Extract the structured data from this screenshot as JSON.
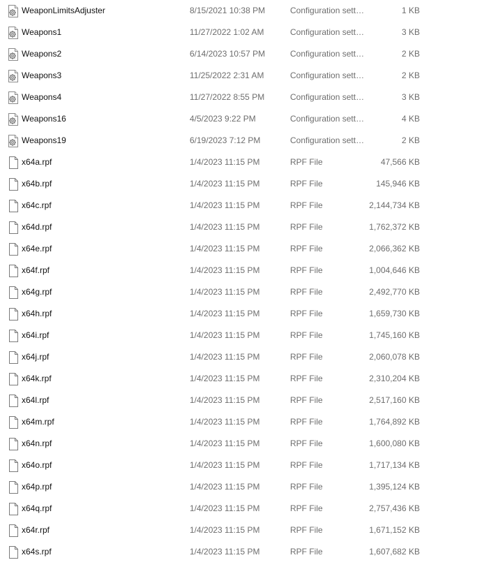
{
  "files": [
    {
      "name": "WeaponLimitsAdjuster",
      "date": "8/15/2021 10:38 PM",
      "type": "Configuration settings",
      "size": "1 KB",
      "icon": "config-file-icon"
    },
    {
      "name": "Weapons1",
      "date": "11/27/2022 1:02 AM",
      "type": "Configuration settings",
      "size": "3 KB",
      "icon": "config-file-icon"
    },
    {
      "name": "Weapons2",
      "date": "6/14/2023 10:57 PM",
      "type": "Configuration settings",
      "size": "2 KB",
      "icon": "config-file-icon"
    },
    {
      "name": "Weapons3",
      "date": "11/25/2022 2:31 AM",
      "type": "Configuration settings",
      "size": "2 KB",
      "icon": "config-file-icon"
    },
    {
      "name": "Weapons4",
      "date": "11/27/2022 8:55 PM",
      "type": "Configuration settings",
      "size": "3 KB",
      "icon": "config-file-icon"
    },
    {
      "name": "Weapons16",
      "date": "4/5/2023 9:22 PM",
      "type": "Configuration settings",
      "size": "4 KB",
      "icon": "config-file-icon"
    },
    {
      "name": "Weapons19",
      "date": "6/19/2023 7:12 PM",
      "type": "Configuration settings",
      "size": "2 KB",
      "icon": "config-file-icon"
    },
    {
      "name": "x64a.rpf",
      "date": "1/4/2023 11:15 PM",
      "type": "RPF File",
      "size": "47,566 KB",
      "icon": "blank-file-icon"
    },
    {
      "name": "x64b.rpf",
      "date": "1/4/2023 11:15 PM",
      "type": "RPF File",
      "size": "145,946 KB",
      "icon": "blank-file-icon"
    },
    {
      "name": "x64c.rpf",
      "date": "1/4/2023 11:15 PM",
      "type": "RPF File",
      "size": "2,144,734 KB",
      "icon": "blank-file-icon"
    },
    {
      "name": "x64d.rpf",
      "date": "1/4/2023 11:15 PM",
      "type": "RPF File",
      "size": "1,762,372 KB",
      "icon": "blank-file-icon"
    },
    {
      "name": "x64e.rpf",
      "date": "1/4/2023 11:15 PM",
      "type": "RPF File",
      "size": "2,066,362 KB",
      "icon": "blank-file-icon"
    },
    {
      "name": "x64f.rpf",
      "date": "1/4/2023 11:15 PM",
      "type": "RPF File",
      "size": "1,004,646 KB",
      "icon": "blank-file-icon"
    },
    {
      "name": "x64g.rpf",
      "date": "1/4/2023 11:15 PM",
      "type": "RPF File",
      "size": "2,492,770 KB",
      "icon": "blank-file-icon"
    },
    {
      "name": "x64h.rpf",
      "date": "1/4/2023 11:15 PM",
      "type": "RPF File",
      "size": "1,659,730 KB",
      "icon": "blank-file-icon"
    },
    {
      "name": "x64i.rpf",
      "date": "1/4/2023 11:15 PM",
      "type": "RPF File",
      "size": "1,745,160 KB",
      "icon": "blank-file-icon"
    },
    {
      "name": "x64j.rpf",
      "date": "1/4/2023 11:15 PM",
      "type": "RPF File",
      "size": "2,060,078 KB",
      "icon": "blank-file-icon"
    },
    {
      "name": "x64k.rpf",
      "date": "1/4/2023 11:15 PM",
      "type": "RPF File",
      "size": "2,310,204 KB",
      "icon": "blank-file-icon"
    },
    {
      "name": "x64l.rpf",
      "date": "1/4/2023 11:15 PM",
      "type": "RPF File",
      "size": "2,517,160 KB",
      "icon": "blank-file-icon"
    },
    {
      "name": "x64m.rpf",
      "date": "1/4/2023 11:15 PM",
      "type": "RPF File",
      "size": "1,764,892 KB",
      "icon": "blank-file-icon"
    },
    {
      "name": "x64n.rpf",
      "date": "1/4/2023 11:15 PM",
      "type": "RPF File",
      "size": "1,600,080 KB",
      "icon": "blank-file-icon"
    },
    {
      "name": "x64o.rpf",
      "date": "1/4/2023 11:15 PM",
      "type": "RPF File",
      "size": "1,717,134 KB",
      "icon": "blank-file-icon"
    },
    {
      "name": "x64p.rpf",
      "date": "1/4/2023 11:15 PM",
      "type": "RPF File",
      "size": "1,395,124 KB",
      "icon": "blank-file-icon"
    },
    {
      "name": "x64q.rpf",
      "date": "1/4/2023 11:15 PM",
      "type": "RPF File",
      "size": "2,757,436 KB",
      "icon": "blank-file-icon"
    },
    {
      "name": "x64r.rpf",
      "date": "1/4/2023 11:15 PM",
      "type": "RPF File",
      "size": "1,671,152 KB",
      "icon": "blank-file-icon"
    },
    {
      "name": "x64s.rpf",
      "date": "1/4/2023 11:15 PM",
      "type": "RPF File",
      "size": "1,607,682 KB",
      "icon": "blank-file-icon"
    }
  ]
}
